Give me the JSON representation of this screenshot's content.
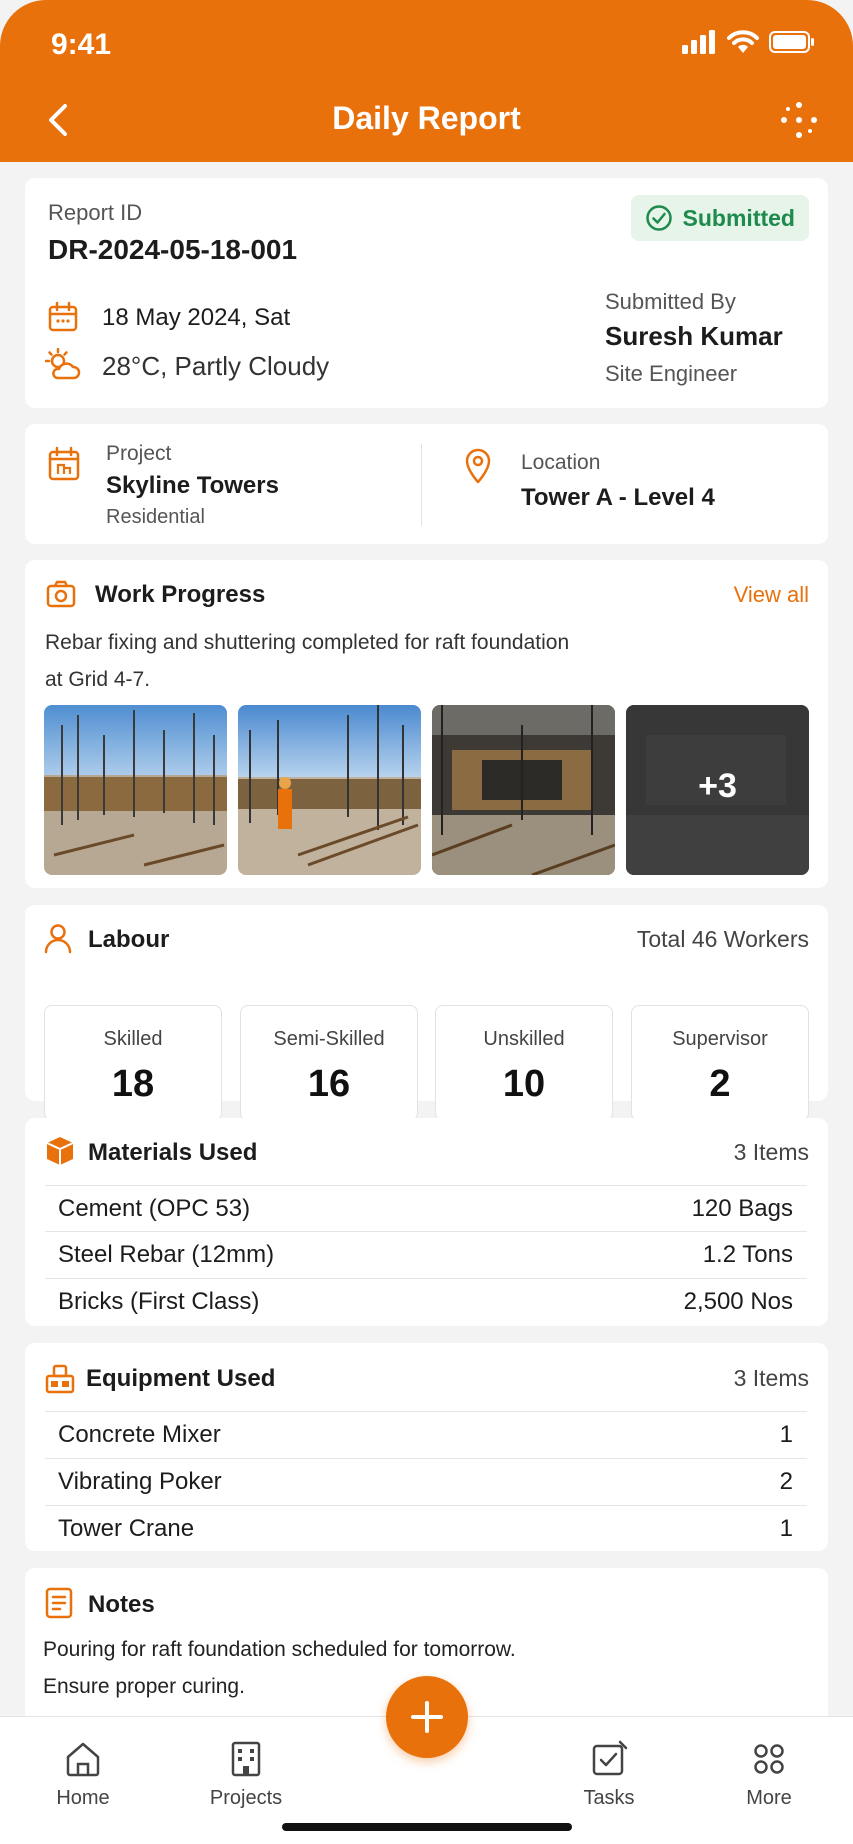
{
  "status_bar": {
    "time": "9:41"
  },
  "nav": {
    "title": "Daily Report"
  },
  "report": {
    "id_label": "Report ID",
    "id": "DR-2024-05-18-001",
    "status": "Submitted",
    "date": "18 May 2024, Sat",
    "weather": "28°C, Partly Cloudy",
    "submitted_by_label": "Submitted By",
    "submitted_by": "Suresh Kumar",
    "role": "Site Engineer"
  },
  "project": {
    "label": "Project",
    "name": "Skyline Towers",
    "type": "Residential",
    "location_label": "Location",
    "location": "Tower A - Level 4"
  },
  "work_progress": {
    "title": "Work Progress",
    "view_all": "View all",
    "description_line1": "Rebar fixing and shuttering completed for raft foundation",
    "description_line2": "at Grid 4-7.",
    "more_photos": "+3"
  },
  "labour": {
    "title": "Labour",
    "total": "Total 46 Workers",
    "groups": [
      {
        "label": "Skilled",
        "value": "18"
      },
      {
        "label": "Semi-Skilled",
        "value": "16"
      },
      {
        "label": "Unskilled",
        "value": "10"
      },
      {
        "label": "Supervisor",
        "value": "2"
      }
    ]
  },
  "materials": {
    "title": "Materials Used",
    "count": "3 Items",
    "items": [
      {
        "name": "Cement (OPC 53)",
        "qty": "120 Bags"
      },
      {
        "name": "Steel Rebar (12mm)",
        "qty": "1.2 Tons"
      },
      {
        "name": "Bricks (First Class)",
        "qty": "2,500 Nos"
      }
    ]
  },
  "equipment": {
    "title": "Equipment Used",
    "count": "3 Items",
    "items": [
      {
        "name": "Concrete Mixer",
        "qty": "1"
      },
      {
        "name": "Vibrating Poker",
        "qty": "2"
      },
      {
        "name": "Tower Crane",
        "qty": "1"
      }
    ]
  },
  "notes": {
    "title": "Notes",
    "line1": "Pouring for raft foundation scheduled for tomorrow.",
    "line2": "Ensure proper curing."
  },
  "tabs": {
    "home": "Home",
    "projects": "Projects",
    "tasks": "Tasks",
    "more": "More"
  },
  "colors": {
    "accent": "#e8710c",
    "success": "#1e8a4c",
    "success_bg": "#e6f4ea"
  }
}
